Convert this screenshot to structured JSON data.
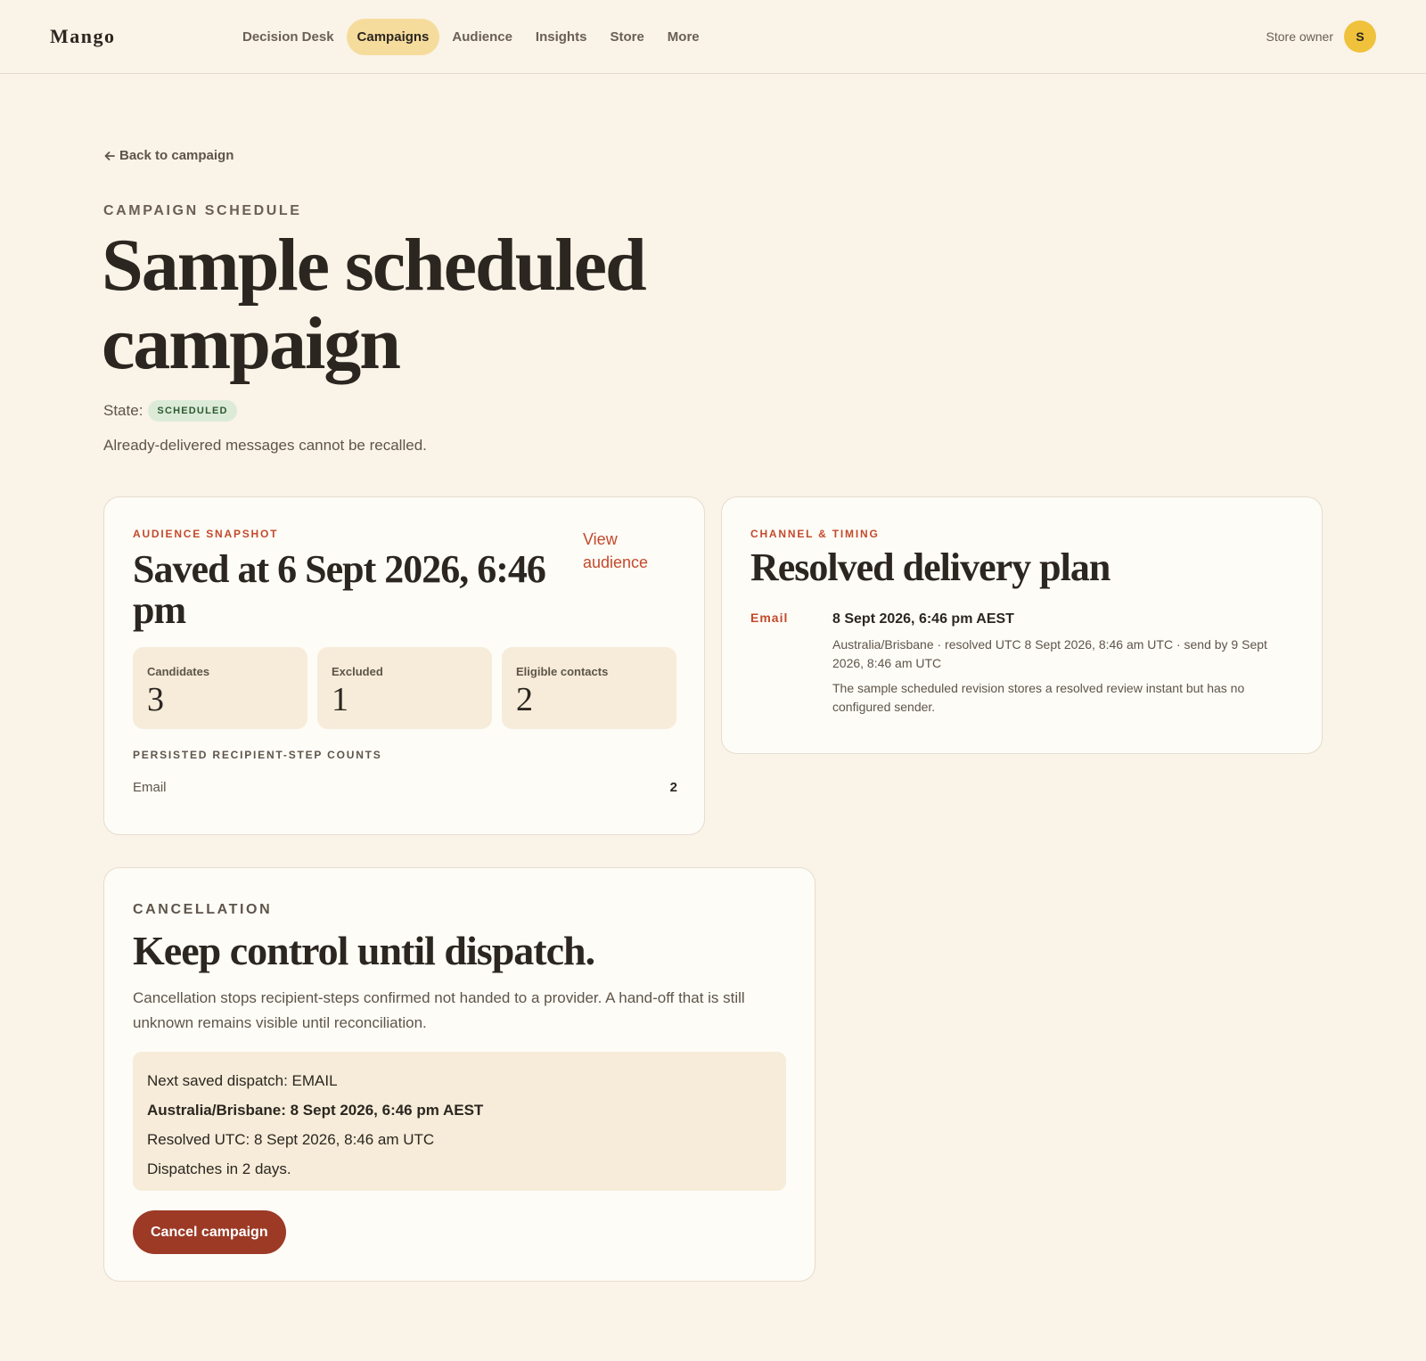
{
  "app": {
    "logo": "Mango"
  },
  "nav": {
    "items": [
      {
        "label": "Decision Desk",
        "active": false
      },
      {
        "label": "Campaigns",
        "active": true
      },
      {
        "label": "Audience",
        "active": false
      },
      {
        "label": "Insights",
        "active": false
      },
      {
        "label": "Store",
        "active": false
      },
      {
        "label": "More",
        "active": false
      }
    ]
  },
  "user": {
    "role": "Store owner",
    "initial": "S"
  },
  "header": {
    "back_label": "Back to campaign",
    "eyebrow": "CAMPAIGN SCHEDULE",
    "title": "Sample scheduled campaign",
    "state_label": "State:",
    "state_badge": "SCHEDULED",
    "note": "Already-delivered messages cannot be recalled."
  },
  "audience": {
    "kicker": "AUDIENCE SNAPSHOT",
    "title": "Saved at 6 Sept 2026, 6:46 pm",
    "link": "View audience",
    "stats": [
      {
        "label": "Candidates",
        "value": "3"
      },
      {
        "label": "Excluded",
        "value": "1"
      },
      {
        "label": "Eligible contacts",
        "value": "2"
      }
    ],
    "counts_heading": "PERSISTED RECIPIENT-STEP COUNTS",
    "counts": [
      {
        "channel": "Email",
        "count": "2"
      }
    ]
  },
  "channel": {
    "kicker": "CHANNEL & TIMING",
    "title": "Resolved delivery plan",
    "name": "Email",
    "when": "8 Sept 2026, 6:46 pm AEST",
    "meta": "Australia/Brisbane · resolved UTC 8 Sept 2026, 8:46 am UTC · send by 9 Sept 2026, 8:46 am UTC",
    "note": "The sample scheduled revision stores a resolved review instant but has no configured sender."
  },
  "cancellation": {
    "eyebrow": "CANCELLATION",
    "title": "Keep control until dispatch.",
    "description": "Cancellation stops recipient-steps confirmed not handed to a provider. A hand-off that is still unknown remains visible until reconciliation.",
    "next_dispatch": "Next saved dispatch: EMAIL",
    "local_time": "Australia/Brisbane: 8 Sept 2026, 6:46 pm AEST",
    "utc_time": "Resolved UTC: 8 Sept 2026, 8:46 am UTC",
    "countdown": "Dispatches in 2 days.",
    "button": "Cancel campaign"
  },
  "colors": {
    "background": "#faf3e8",
    "accent": "#c24a2c",
    "active_nav": "#f6dc9c",
    "danger_button": "#9c3a26",
    "badge_bg": "#dcebd8",
    "avatar": "#f0c13a"
  },
  "icons": {
    "back": "arrow-left-icon"
  }
}
